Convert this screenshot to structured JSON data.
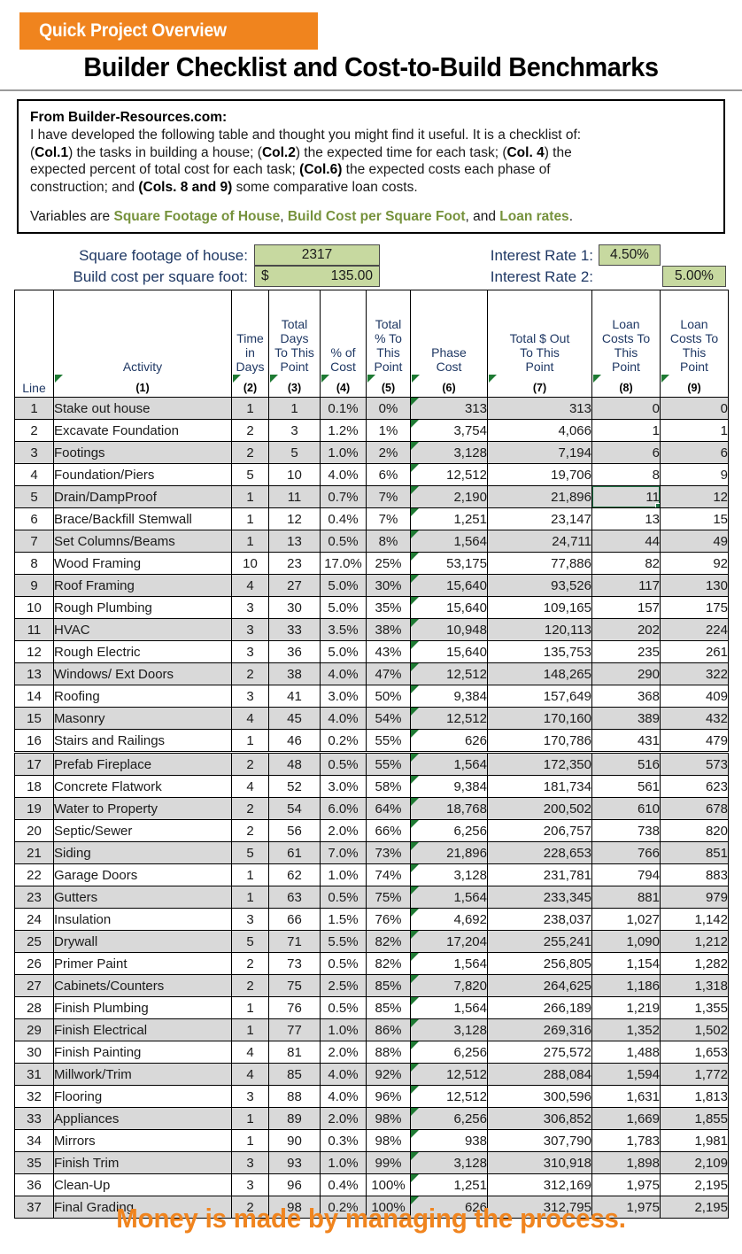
{
  "header": {
    "banner_label": "Quick Project Overview",
    "title": "Builder Checklist and Cost-to-Build Benchmarks",
    "banner_color": "#F0841E"
  },
  "note": {
    "heading": "From Builder-Resources.com:",
    "line1_a": "I have developed the following table and thought you might find it useful.  It is a checklist of:",
    "line2_a": "(",
    "line2_b": "Col.1",
    "line2_c": ") the tasks in building a house; (",
    "line2_d": "Col.2",
    "line2_e": ") the expected time for each task; (",
    "line2_f": "Col. 4",
    "line2_g": ") the",
    "line3_a": "expected percent of total cost for each task; ",
    "line3_b": "(Col.6)",
    "line3_c": " the expected costs each phase of",
    "line4_a": "construction; and ",
    "line4_b": "(Cols. 8 and 9)",
    "line4_c": " some comparative loan costs.",
    "var_intro": "Variables are ",
    "var1": "Square Footage of House",
    "var_sep1": ", ",
    "var2": "Build Cost per Square Foot",
    "var_sep2": ", and ",
    "var3": "Loan rates",
    "var_end": ".",
    "accent_color": "#76923C"
  },
  "inputs": {
    "sqft_label": "Square footage of house:",
    "sqft_value": "2317",
    "cost_label": "Build cost per square foot:",
    "cost_currency": "$",
    "cost_value": "135.00",
    "rate1_label": "Interest Rate 1:",
    "rate1_value": "4.50%",
    "rate2_label": "Interest Rate 2:",
    "rate2_value": "5.00%",
    "input_fill": "#C7D9A0"
  },
  "table": {
    "headers": [
      {
        "lines": "Line",
        "num": ""
      },
      {
        "lines": "Activity",
        "num": "(1)"
      },
      {
        "lines": "Time\nin\nDays",
        "num": "(2)"
      },
      {
        "lines": "Total\nDays\nTo This\nPoint",
        "num": "(3)"
      },
      {
        "lines": "% of\nCost",
        "num": "(4)"
      },
      {
        "lines": "Total\n% To\nThis\nPoint",
        "num": "(5)"
      },
      {
        "lines": "Phase\nCost",
        "num": "(6)"
      },
      {
        "lines": "Total $ Out\nTo This\nPoint",
        "num": "(7)"
      },
      {
        "lines": "Loan\nCosts To\nThis\nPoint",
        "num": "(8)"
      },
      {
        "lines": "Loan\nCosts To\nThis\nPoint",
        "num": "(9)"
      }
    ],
    "rows": [
      {
        "line": "1",
        "activity": "Stake out house",
        "days": "1",
        "total_days": "1",
        "pct_cost": "0.1%",
        "total_pct": "0%",
        "phase_cost": "313",
        "total_out": "313",
        "loan1": "0",
        "loan2": "0"
      },
      {
        "line": "2",
        "activity": "Excavate Foundation",
        "days": "2",
        "total_days": "3",
        "pct_cost": "1.2%",
        "total_pct": "1%",
        "phase_cost": "3,754",
        "total_out": "4,066",
        "loan1": "1",
        "loan2": "1"
      },
      {
        "line": "3",
        "activity": "Footings",
        "days": "2",
        "total_days": "5",
        "pct_cost": "1.0%",
        "total_pct": "2%",
        "phase_cost": "3,128",
        "total_out": "7,194",
        "loan1": "6",
        "loan2": "6"
      },
      {
        "line": "4",
        "activity": "Foundation/Piers",
        "days": "5",
        "total_days": "10",
        "pct_cost": "4.0%",
        "total_pct": "6%",
        "phase_cost": "12,512",
        "total_out": "19,706",
        "loan1": "8",
        "loan2": "9"
      },
      {
        "line": "5",
        "activity": "Drain/DampProof",
        "days": "1",
        "total_days": "11",
        "pct_cost": "0.7%",
        "total_pct": "7%",
        "phase_cost": "2,190",
        "total_out": "21,896",
        "loan1": "11",
        "loan2": "12"
      },
      {
        "line": "6",
        "activity": "Brace/Backfill Stemwall",
        "days": "1",
        "total_days": "12",
        "pct_cost": "0.4%",
        "total_pct": "7%",
        "phase_cost": "1,251",
        "total_out": "23,147",
        "loan1": "13",
        "loan2": "15"
      },
      {
        "line": "7",
        "activity": "Set Columns/Beams",
        "days": "1",
        "total_days": "13",
        "pct_cost": "0.5%",
        "total_pct": "8%",
        "phase_cost": "1,564",
        "total_out": "24,711",
        "loan1": "44",
        "loan2": "49"
      },
      {
        "line": "8",
        "activity": "Wood Framing",
        "days": "10",
        "total_days": "23",
        "pct_cost": "17.0%",
        "total_pct": "25%",
        "phase_cost": "53,175",
        "total_out": "77,886",
        "loan1": "82",
        "loan2": "92"
      },
      {
        "line": "9",
        "activity": "Roof Framing",
        "days": "4",
        "total_days": "27",
        "pct_cost": "5.0%",
        "total_pct": "30%",
        "phase_cost": "15,640",
        "total_out": "93,526",
        "loan1": "117",
        "loan2": "130"
      },
      {
        "line": "10",
        "activity": "Rough Plumbing",
        "days": "3",
        "total_days": "30",
        "pct_cost": "5.0%",
        "total_pct": "35%",
        "phase_cost": "15,640",
        "total_out": "109,165",
        "loan1": "157",
        "loan2": "175"
      },
      {
        "line": "11",
        "activity": "HVAC",
        "days": "3",
        "total_days": "33",
        "pct_cost": "3.5%",
        "total_pct": "38%",
        "phase_cost": "10,948",
        "total_out": "120,113",
        "loan1": "202",
        "loan2": "224"
      },
      {
        "line": "12",
        "activity": "Rough Electric",
        "days": "3",
        "total_days": "36",
        "pct_cost": "5.0%",
        "total_pct": "43%",
        "phase_cost": "15,640",
        "total_out": "135,753",
        "loan1": "235",
        "loan2": "261"
      },
      {
        "line": "13",
        "activity": "Windows/ Ext Doors",
        "days": "2",
        "total_days": "38",
        "pct_cost": "4.0%",
        "total_pct": "47%",
        "phase_cost": "12,512",
        "total_out": "148,265",
        "loan1": "290",
        "loan2": "322"
      },
      {
        "line": "14",
        "activity": "Roofing",
        "days": "3",
        "total_days": "41",
        "pct_cost": "3.0%",
        "total_pct": "50%",
        "phase_cost": "9,384",
        "total_out": "157,649",
        "loan1": "368",
        "loan2": "409"
      },
      {
        "line": "15",
        "activity": "Masonry",
        "days": "4",
        "total_days": "45",
        "pct_cost": "4.0%",
        "total_pct": "54%",
        "phase_cost": "12,512",
        "total_out": "170,160",
        "loan1": "389",
        "loan2": "432"
      },
      {
        "line": "16",
        "activity": "Stairs and Railings",
        "days": "1",
        "total_days": "46",
        "pct_cost": "0.2%",
        "total_pct": "55%",
        "phase_cost": "626",
        "total_out": "170,786",
        "loan1": "431",
        "loan2": "479"
      },
      {
        "line": "17",
        "activity": "Prefab Fireplace",
        "days": "2",
        "total_days": "48",
        "pct_cost": "0.5%",
        "total_pct": "55%",
        "phase_cost": "1,564",
        "total_out": "172,350",
        "loan1": "516",
        "loan2": "573"
      },
      {
        "line": "18",
        "activity": "Concrete Flatwork",
        "days": "4",
        "total_days": "52",
        "pct_cost": "3.0%",
        "total_pct": "58%",
        "phase_cost": "9,384",
        "total_out": "181,734",
        "loan1": "561",
        "loan2": "623"
      },
      {
        "line": "19",
        "activity": "Water to Property",
        "days": "2",
        "total_days": "54",
        "pct_cost": "6.0%",
        "total_pct": "64%",
        "phase_cost": "18,768",
        "total_out": "200,502",
        "loan1": "610",
        "loan2": "678"
      },
      {
        "line": "20",
        "activity": "Septic/Sewer",
        "days": "2",
        "total_days": "56",
        "pct_cost": "2.0%",
        "total_pct": "66%",
        "phase_cost": "6,256",
        "total_out": "206,757",
        "loan1": "738",
        "loan2": "820"
      },
      {
        "line": "21",
        "activity": "Siding",
        "days": "5",
        "total_days": "61",
        "pct_cost": "7.0%",
        "total_pct": "73%",
        "phase_cost": "21,896",
        "total_out": "228,653",
        "loan1": "766",
        "loan2": "851"
      },
      {
        "line": "22",
        "activity": "Garage Doors",
        "days": "1",
        "total_days": "62",
        "pct_cost": "1.0%",
        "total_pct": "74%",
        "phase_cost": "3,128",
        "total_out": "231,781",
        "loan1": "794",
        "loan2": "883"
      },
      {
        "line": "23",
        "activity": "Gutters",
        "days": "1",
        "total_days": "63",
        "pct_cost": "0.5%",
        "total_pct": "75%",
        "phase_cost": "1,564",
        "total_out": "233,345",
        "loan1": "881",
        "loan2": "979"
      },
      {
        "line": "24",
        "activity": "Insulation",
        "days": "3",
        "total_days": "66",
        "pct_cost": "1.5%",
        "total_pct": "76%",
        "phase_cost": "4,692",
        "total_out": "238,037",
        "loan1": "1,027",
        "loan2": "1,142"
      },
      {
        "line": "25",
        "activity": "Drywall",
        "days": "5",
        "total_days": "71",
        "pct_cost": "5.5%",
        "total_pct": "82%",
        "phase_cost": "17,204",
        "total_out": "255,241",
        "loan1": "1,090",
        "loan2": "1,212"
      },
      {
        "line": "26",
        "activity": "Primer Paint",
        "days": "2",
        "total_days": "73",
        "pct_cost": "0.5%",
        "total_pct": "82%",
        "phase_cost": "1,564",
        "total_out": "256,805",
        "loan1": "1,154",
        "loan2": "1,282"
      },
      {
        "line": "27",
        "activity": "Cabinets/Counters",
        "days": "2",
        "total_days": "75",
        "pct_cost": "2.5%",
        "total_pct": "85%",
        "phase_cost": "7,820",
        "total_out": "264,625",
        "loan1": "1,186",
        "loan2": "1,318"
      },
      {
        "line": "28",
        "activity": "Finish Plumbing",
        "days": "1",
        "total_days": "76",
        "pct_cost": "0.5%",
        "total_pct": "85%",
        "phase_cost": "1,564",
        "total_out": "266,189",
        "loan1": "1,219",
        "loan2": "1,355"
      },
      {
        "line": "29",
        "activity": "Finish Electrical",
        "days": "1",
        "total_days": "77",
        "pct_cost": "1.0%",
        "total_pct": "86%",
        "phase_cost": "3,128",
        "total_out": "269,316",
        "loan1": "1,352",
        "loan2": "1,502"
      },
      {
        "line": "30",
        "activity": "Finish Painting",
        "days": "4",
        "total_days": "81",
        "pct_cost": "2.0%",
        "total_pct": "88%",
        "phase_cost": "6,256",
        "total_out": "275,572",
        "loan1": "1,488",
        "loan2": "1,653"
      },
      {
        "line": "31",
        "activity": "Millwork/Trim",
        "days": "4",
        "total_days": "85",
        "pct_cost": "4.0%",
        "total_pct": "92%",
        "phase_cost": "12,512",
        "total_out": "288,084",
        "loan1": "1,594",
        "loan2": "1,772"
      },
      {
        "line": "32",
        "activity": "Flooring",
        "days": "3",
        "total_days": "88",
        "pct_cost": "4.0%",
        "total_pct": "96%",
        "phase_cost": "12,512",
        "total_out": "300,596",
        "loan1": "1,631",
        "loan2": "1,813"
      },
      {
        "line": "33",
        "activity": "Appliances",
        "days": "1",
        "total_days": "89",
        "pct_cost": "2.0%",
        "total_pct": "98%",
        "phase_cost": "6,256",
        "total_out": "306,852",
        "loan1": "1,669",
        "loan2": "1,855"
      },
      {
        "line": "34",
        "activity": "Mirrors",
        "days": "1",
        "total_days": "90",
        "pct_cost": "0.3%",
        "total_pct": "98%",
        "phase_cost": "938",
        "total_out": "307,790",
        "loan1": "1,783",
        "loan2": "1,981"
      },
      {
        "line": "35",
        "activity": "Finish Trim",
        "days": "3",
        "total_days": "93",
        "pct_cost": "1.0%",
        "total_pct": "99%",
        "phase_cost": "3,128",
        "total_out": "310,918",
        "loan1": "1,898",
        "loan2": "2,109"
      },
      {
        "line": "36",
        "activity": "Clean-Up",
        "days": "3",
        "total_days": "96",
        "pct_cost": "0.4%",
        "total_pct": "100%",
        "phase_cost": "1,251",
        "total_out": "312,169",
        "loan1": "1,975",
        "loan2": "2,195"
      },
      {
        "line": "37",
        "activity": "Final Grading",
        "days": "2",
        "total_days": "98",
        "pct_cost": "0.2%",
        "total_pct": "100%",
        "phase_cost": "626",
        "total_out": "312,795",
        "loan1": "1,975",
        "loan2": "2,195"
      }
    ],
    "selected_cell": {
      "row_index": 4,
      "column": "loan1",
      "value": "11",
      "border_color": "#217346"
    }
  },
  "footer": {
    "text": "Money is made by managing the process.",
    "color": "#F0841E"
  }
}
